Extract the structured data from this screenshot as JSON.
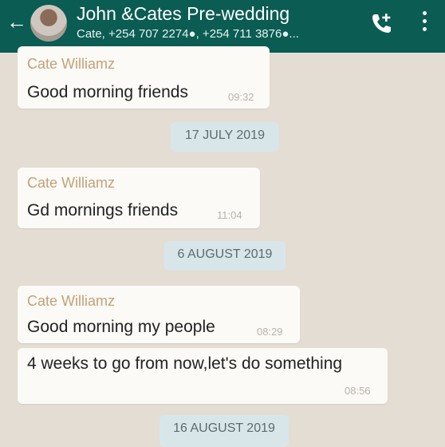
{
  "header": {
    "title": "John &Cates Pre-wedding",
    "subtitle": "Cate, +254 707 2274●, +254 711 3876●...",
    "back_icon": "arrow-left-icon",
    "call_icon": "add-call-icon",
    "menu_icon": "more-vert-icon",
    "bar_color": "#0b5c53"
  },
  "messages": [
    {
      "sender": "Cate Williamz",
      "text": "Good morning friends",
      "time": "09:32"
    },
    {
      "sender": "Cate Williamz",
      "text": "Gd mornings friends",
      "time": "11:04"
    },
    {
      "sender": "Cate Williamz",
      "text": "Good morning my people",
      "time": "08:29"
    },
    {
      "text": "4  weeks to go from now,let's do something",
      "time": "08:56"
    }
  ],
  "dates": [
    "17 JULY 2019",
    "6 AUGUST 2019",
    "16 AUGUST 2019"
  ]
}
